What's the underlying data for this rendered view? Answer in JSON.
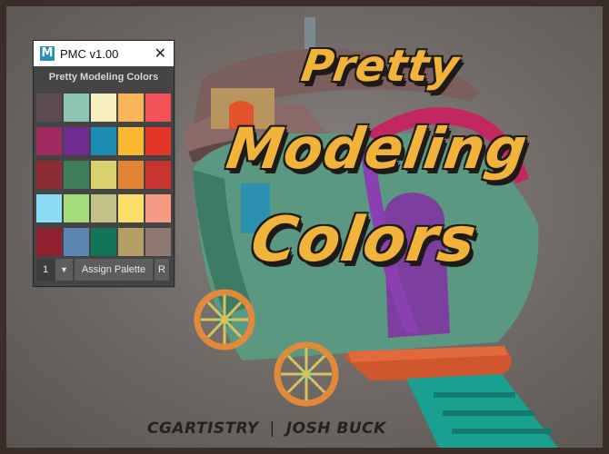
{
  "window": {
    "title": "PMC v1.00",
    "app_icon_letter": "M",
    "close_glyph": "✕",
    "subtitle": "Pretty Modeling Colors"
  },
  "palette": {
    "rows": [
      [
        "#5b4a4f",
        "#8ec4b4",
        "#f6f0c0",
        "#f9b55a",
        "#f2515a"
      ],
      [
        "#a02b62",
        "#6e2c93",
        "#1d8cb2",
        "#f8b934",
        "#e23628"
      ],
      [
        "#8e2c33",
        "#3f7d59",
        "#d9d070",
        "#e38434",
        "#c7332e"
      ],
      [
        "#8ddcf6",
        "#a4dc7c",
        "#c4c187",
        "#f9de6c",
        "#f79a84"
      ],
      [
        "#8e2030",
        "#5c85b2",
        "#12755a",
        "#b2a064",
        "#8e7870"
      ]
    ]
  },
  "controls": {
    "palette_number": "1",
    "dropdown_glyph": "▼",
    "assign_label": "Assign Palette",
    "r_label": "R"
  },
  "artwork": {
    "title_line1": "Pretty",
    "title_line2": "Modeling",
    "title_line3": "Colors",
    "credit_left": "CGARTISTRY",
    "credit_sep": "|",
    "credit_right": "JOSH BUCK"
  }
}
